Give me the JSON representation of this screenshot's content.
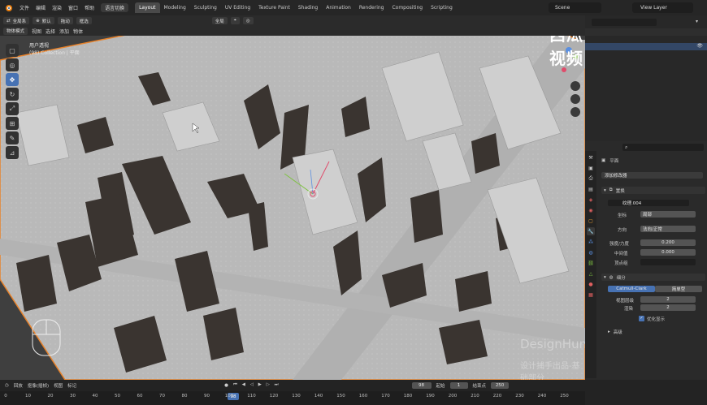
{
  "menubar": {
    "items": [
      "文件",
      "编辑",
      "渲染",
      "窗口",
      "帮助"
    ],
    "mode_label": "语言切换",
    "workspaces": [
      "Layout",
      "Modeling",
      "Sculpting",
      "UV Editing",
      "Texture Paint",
      "Shading",
      "Animation",
      "Rendering",
      "Compositing",
      "Scripting"
    ],
    "active_workspace": "Layout",
    "scene_name": "Scene",
    "view_layer": "View Layer"
  },
  "header": {
    "orientation_label": "全局系",
    "pivot_label": "默认",
    "snap_label": "拖动",
    "snap_mode": "框选",
    "transform_label": "全局",
    "object_mode": "物体模式",
    "menu": [
      "视图",
      "选择",
      "添加",
      "物体"
    ]
  },
  "viewport": {
    "view_name": "用户透视",
    "collection": "(98) Collection | 平面"
  },
  "properties": {
    "search_placeholder": "",
    "object_name": "平面",
    "add_modifier": "添加修改器",
    "displace": {
      "name": "置换",
      "texture": "纹理.004",
      "coords_label": "坐标",
      "coords_value": "局部",
      "direction_label": "方向",
      "direction_value": "法向/正常",
      "strength_label": "强度/力度",
      "strength_value": "0.200",
      "midlevel_label": "中间值",
      "midlevel_value": "0.000",
      "vgroup_label": "顶点组"
    },
    "subsurf": {
      "name": "细分",
      "type_a": "Catmull-Clark",
      "type_b": "简单型",
      "viewport_label": "视图层级",
      "viewport_value": "2",
      "render_label": "渲染",
      "render_value": "2",
      "optimal_label": "优化显示",
      "advanced_label": "高级"
    }
  },
  "timeline": {
    "menu": [
      "回放",
      "抠像(插帧)",
      "视图",
      "标记"
    ],
    "current_frame": "98",
    "start_label": "起始",
    "start_value": "1",
    "end_label": "结束点",
    "end_value": "250",
    "ticks": [
      "0",
      "10",
      "20",
      "30",
      "40",
      "50",
      "60",
      "70",
      "80",
      "90",
      "100",
      "110",
      "120",
      "130",
      "140",
      "150",
      "160",
      "170",
      "180",
      "190",
      "200",
      "210",
      "220",
      "230",
      "240",
      "250"
    ]
  },
  "overlay": {
    "brand": "西瓜视频",
    "watermark_en": "DesignHunting",
    "watermark_cn": "设计捕手出品-基础部分"
  },
  "colors": {
    "accent": "#4772b3",
    "selection_outline": "#e8822a"
  }
}
